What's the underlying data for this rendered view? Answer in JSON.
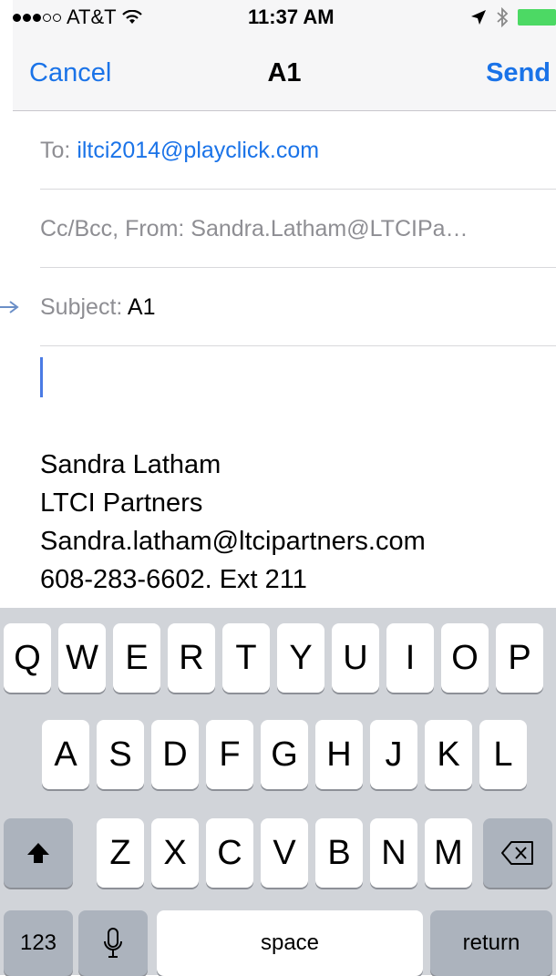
{
  "status_bar": {
    "carrier": "AT&T",
    "time": "11:37 AM",
    "signal_icons": [
      "signal-dots-icon",
      "wifi-icon"
    ],
    "right_icons": [
      "location-arrow-icon",
      "bluetooth-icon",
      "battery-icon"
    ],
    "battery_color": "#4cd964"
  },
  "nav": {
    "cancel_label": "Cancel",
    "title": "A1",
    "send_label": "Send",
    "accent_color": "#1a73e8"
  },
  "fields": {
    "to_label": "To:",
    "to_value": "iltci2014@playclick.com",
    "cc_label": "Cc/Bcc, From:",
    "cc_value": "Sandra.Latham@LTCIPa…",
    "subject_label": "Subject:",
    "subject_value": "A1"
  },
  "body": {
    "signature_lines": [
      "Sandra Latham",
      "LTCI Partners",
      "Sandra.latham@ltcipartners.com",
      "608-283-6602. Ext 211"
    ]
  },
  "keyboard": {
    "row1": [
      "Q",
      "W",
      "E",
      "R",
      "T",
      "Y",
      "U",
      "I",
      "O",
      "P"
    ],
    "row2": [
      "A",
      "S",
      "D",
      "F",
      "G",
      "H",
      "J",
      "K",
      "L"
    ],
    "row3": [
      "Z",
      "X",
      "C",
      "V",
      "B",
      "N",
      "M"
    ],
    "shift_icon": "shift-arrow-icon",
    "delete_icon": "backspace-icon",
    "numbers_label": "123",
    "mic_icon": "microphone-icon",
    "space_label": "space",
    "return_label": "return"
  }
}
